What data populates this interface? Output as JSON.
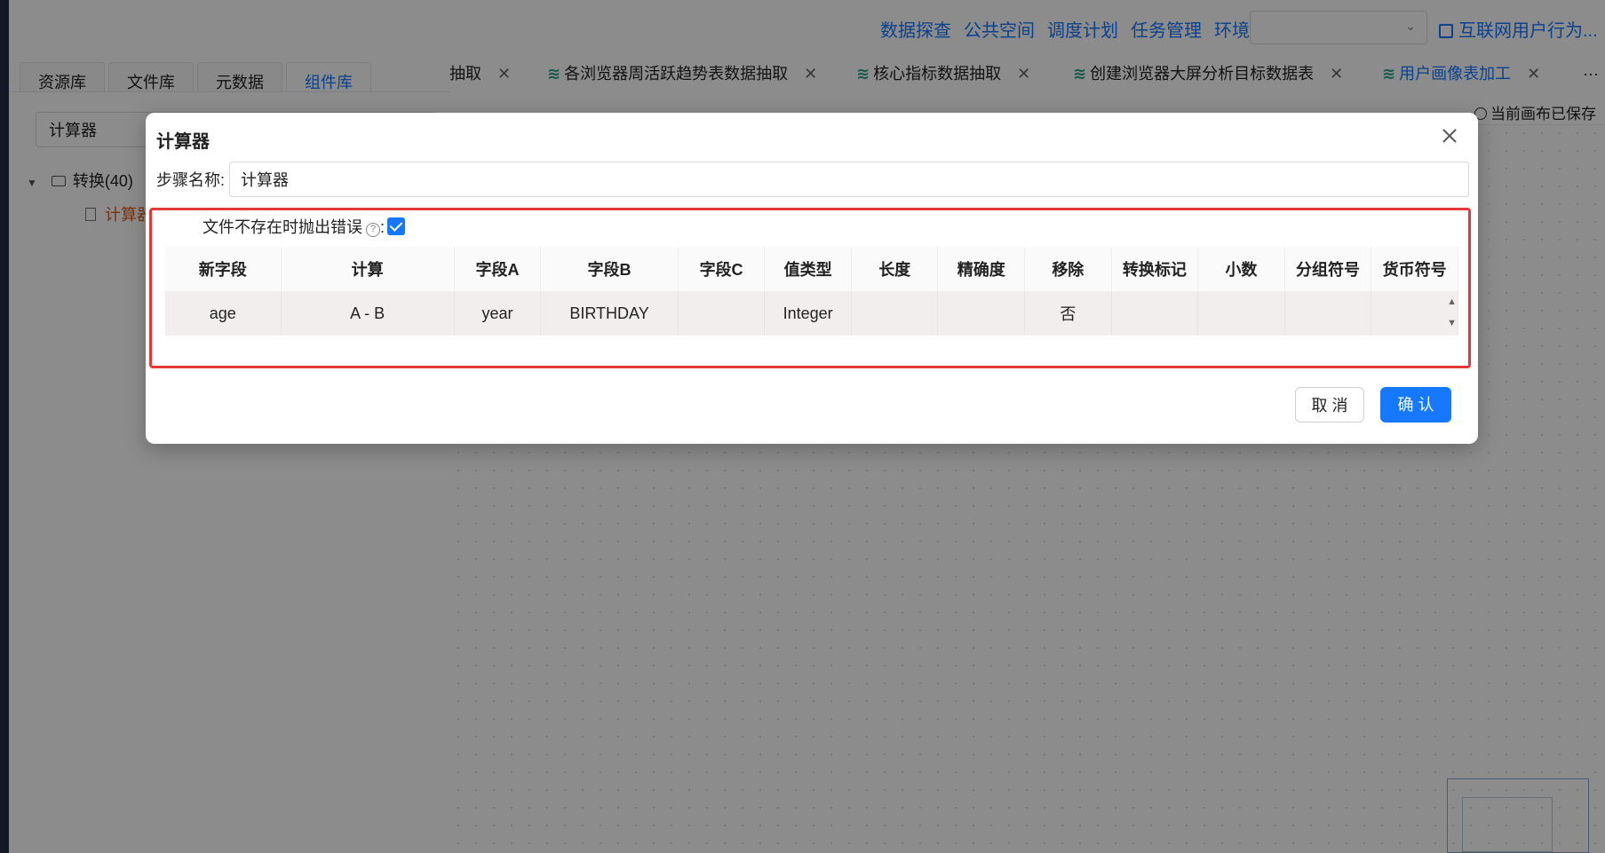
{
  "topnav": {
    "links": [
      "数据探查",
      "公共空间",
      "调度计划",
      "任务管理",
      "环境管理"
    ],
    "select_value": "",
    "project": "互联网用户行为..."
  },
  "left_panel": {
    "tabs": [
      "资源库",
      "文件库",
      "元数据",
      "组件库"
    ],
    "active_tab": "组件库",
    "search_value": "计算器",
    "tree_group": "转换(40)",
    "tree_item": "计算器"
  },
  "editor": {
    "tabs": [
      {
        "label": "抽取",
        "active": false
      },
      {
        "label": "各浏览器周活跃趋势表数据抽取",
        "active": false
      },
      {
        "label": "核心指标数据抽取",
        "active": false
      },
      {
        "label": "创建浏览器大屏分析目标数据表",
        "active": false
      },
      {
        "label": "用户画像表加工",
        "active": true
      }
    ],
    "more": "···",
    "saved_status": "当前画布已保存"
  },
  "modal": {
    "title": "计算器",
    "step_name_label": "步骤名称:",
    "step_name_value": "计算器",
    "checkbox_label": "文件不存在时抛出错误",
    "checkbox_colon": ":",
    "checkbox_checked": true,
    "columns": [
      "新字段",
      "计算",
      "字段A",
      "字段B",
      "字段C",
      "值类型",
      "长度",
      "精确度",
      "移除",
      "转换标记",
      "小数",
      "分组符号",
      "货币符号"
    ],
    "rows": [
      [
        "age",
        "A - B",
        "year",
        "BIRTHDAY",
        "",
        "Integer",
        "",
        "",
        "否",
        "",
        "",
        "",
        ""
      ]
    ],
    "cancel_label": "取 消",
    "ok_label": "确 认"
  },
  "colors": {
    "primary": "#1677ff",
    "highlight_border": "#e53935",
    "tree_active": "#e55a1b"
  }
}
